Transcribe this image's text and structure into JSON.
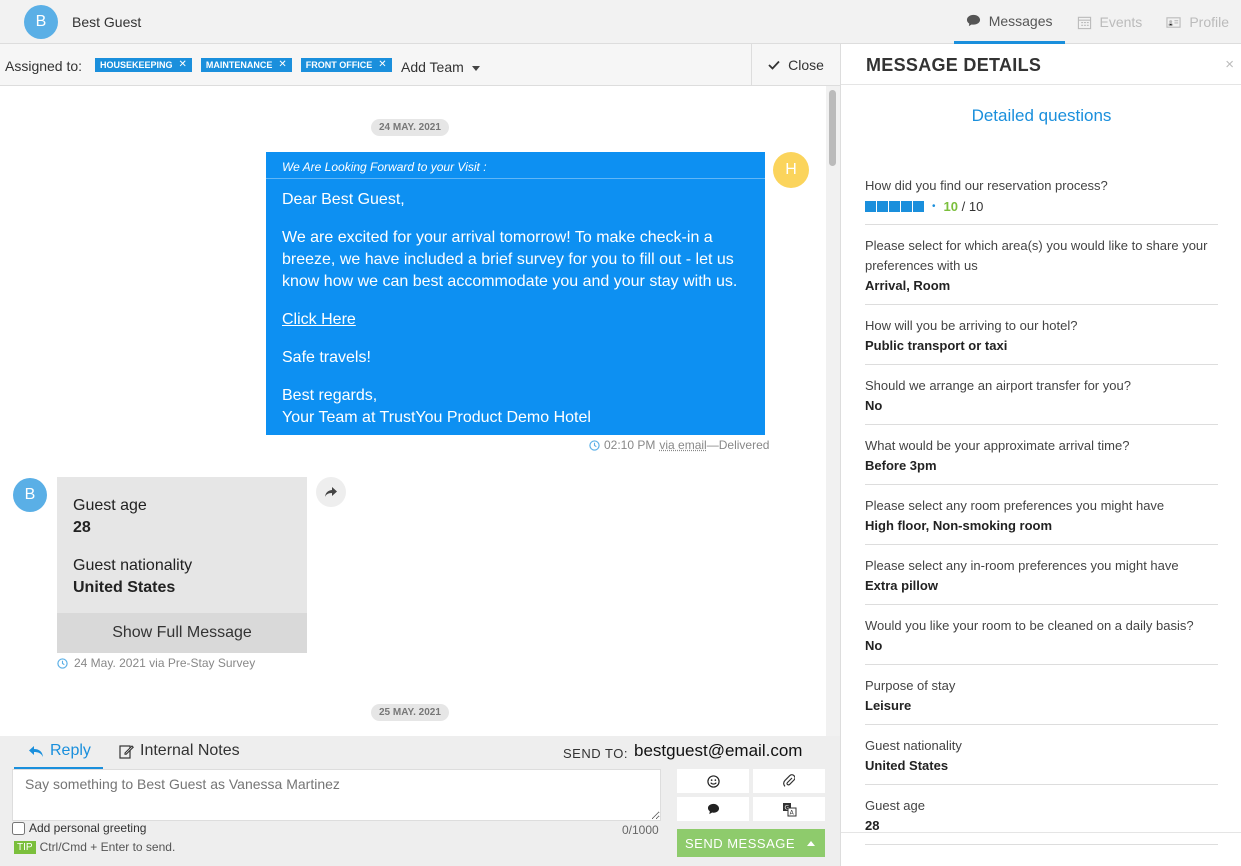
{
  "header": {
    "avatar_initial": "B",
    "guest_name": "Best Guest",
    "tabs": [
      {
        "label": "Messages",
        "icon": "chat-bubble-icon",
        "active": true
      },
      {
        "label": "Events",
        "icon": "calendar-icon",
        "active": false
      },
      {
        "label": "Profile",
        "icon": "id-card-icon",
        "active": false
      }
    ]
  },
  "assignment": {
    "label": "Assigned to:",
    "teams": [
      "HOUSEKEEPING",
      "MAINTENANCE",
      "FRONT OFFICE"
    ],
    "remove_glyph": "✕",
    "add_team_label": "Add Team",
    "close_label": "Close"
  },
  "conversation": {
    "dates": [
      "24 MAY. 2021",
      "25 MAY. 2021"
    ],
    "outgoing": {
      "avatar_initial": "H",
      "subject": "We Are Looking Forward to your Visit :",
      "greeting": "Dear Best Guest,",
      "body": "We are excited for your arrival tomorrow! To make check-in a breeze, we have included a brief survey for you to fill out - let us know how we can best accommodate you and your stay with us.",
      "link_text": "Click Here",
      "closing": "Safe travels!",
      "signoff_1": "Best regards,",
      "signoff_2": "Your Team at TrustYou Product Demo Hotel",
      "time": "02:10 PM",
      "via": "via email",
      "status": "—Delivered"
    },
    "incoming": {
      "avatar_initial": "B",
      "field_1_label": "Guest age",
      "field_1_value": "28",
      "field_2_label": "Guest nationality",
      "field_2_value": "United States",
      "show_full_label": "Show Full Message",
      "meta": "24 May. 2021 via Pre-Stay Survey"
    }
  },
  "composer": {
    "reply_label": "Reply",
    "notes_label": "Internal Notes",
    "send_to_label": "SEND TO: ",
    "send_to_email": "bestguest@email.com",
    "placeholder": "Say something to Best Guest as Vanessa Martinez",
    "greeting_label": "Add personal greeting",
    "counter": "0/1000",
    "tip_badge": "TIP",
    "tip_text": "Ctrl/Cmd + Enter to send.",
    "send_label": "SEND MESSAGE"
  },
  "details": {
    "title": "MESSAGE DETAILS",
    "close_glyph": "×",
    "subtitle": "Detailed questions",
    "rating": {
      "question": "How did you find our reservation process?",
      "score": "10",
      "max": "/ 10",
      "dot": "•",
      "value": 10
    },
    "qa": [
      {
        "q": "Please select for which area(s) you would like to share your preferences with us",
        "a": "Arrival, Room"
      },
      {
        "q": "How will you be arriving to our hotel?",
        "a": "Public transport or taxi"
      },
      {
        "q": "Should we arrange an airport transfer for you?",
        "a": "No"
      },
      {
        "q": "What would be your approximate arrival time?",
        "a": "Before 3pm"
      },
      {
        "q": "Please select any room preferences you might have",
        "a": "High floor, Non-smoking room"
      },
      {
        "q": "Please select any in-room preferences you might have",
        "a": "Extra pillow"
      },
      {
        "q": "Would you like your room to be cleaned on a daily basis?",
        "a": "No"
      },
      {
        "q": "Purpose of stay",
        "a": "Leisure"
      },
      {
        "q": "Guest nationality",
        "a": "United States"
      },
      {
        "q": "Guest age",
        "a": "28"
      }
    ]
  },
  "colors": {
    "accent": "#1a8fdc",
    "bubble": "#0d90f2",
    "send": "#8ecb6c",
    "score": "#7bbf3c"
  }
}
